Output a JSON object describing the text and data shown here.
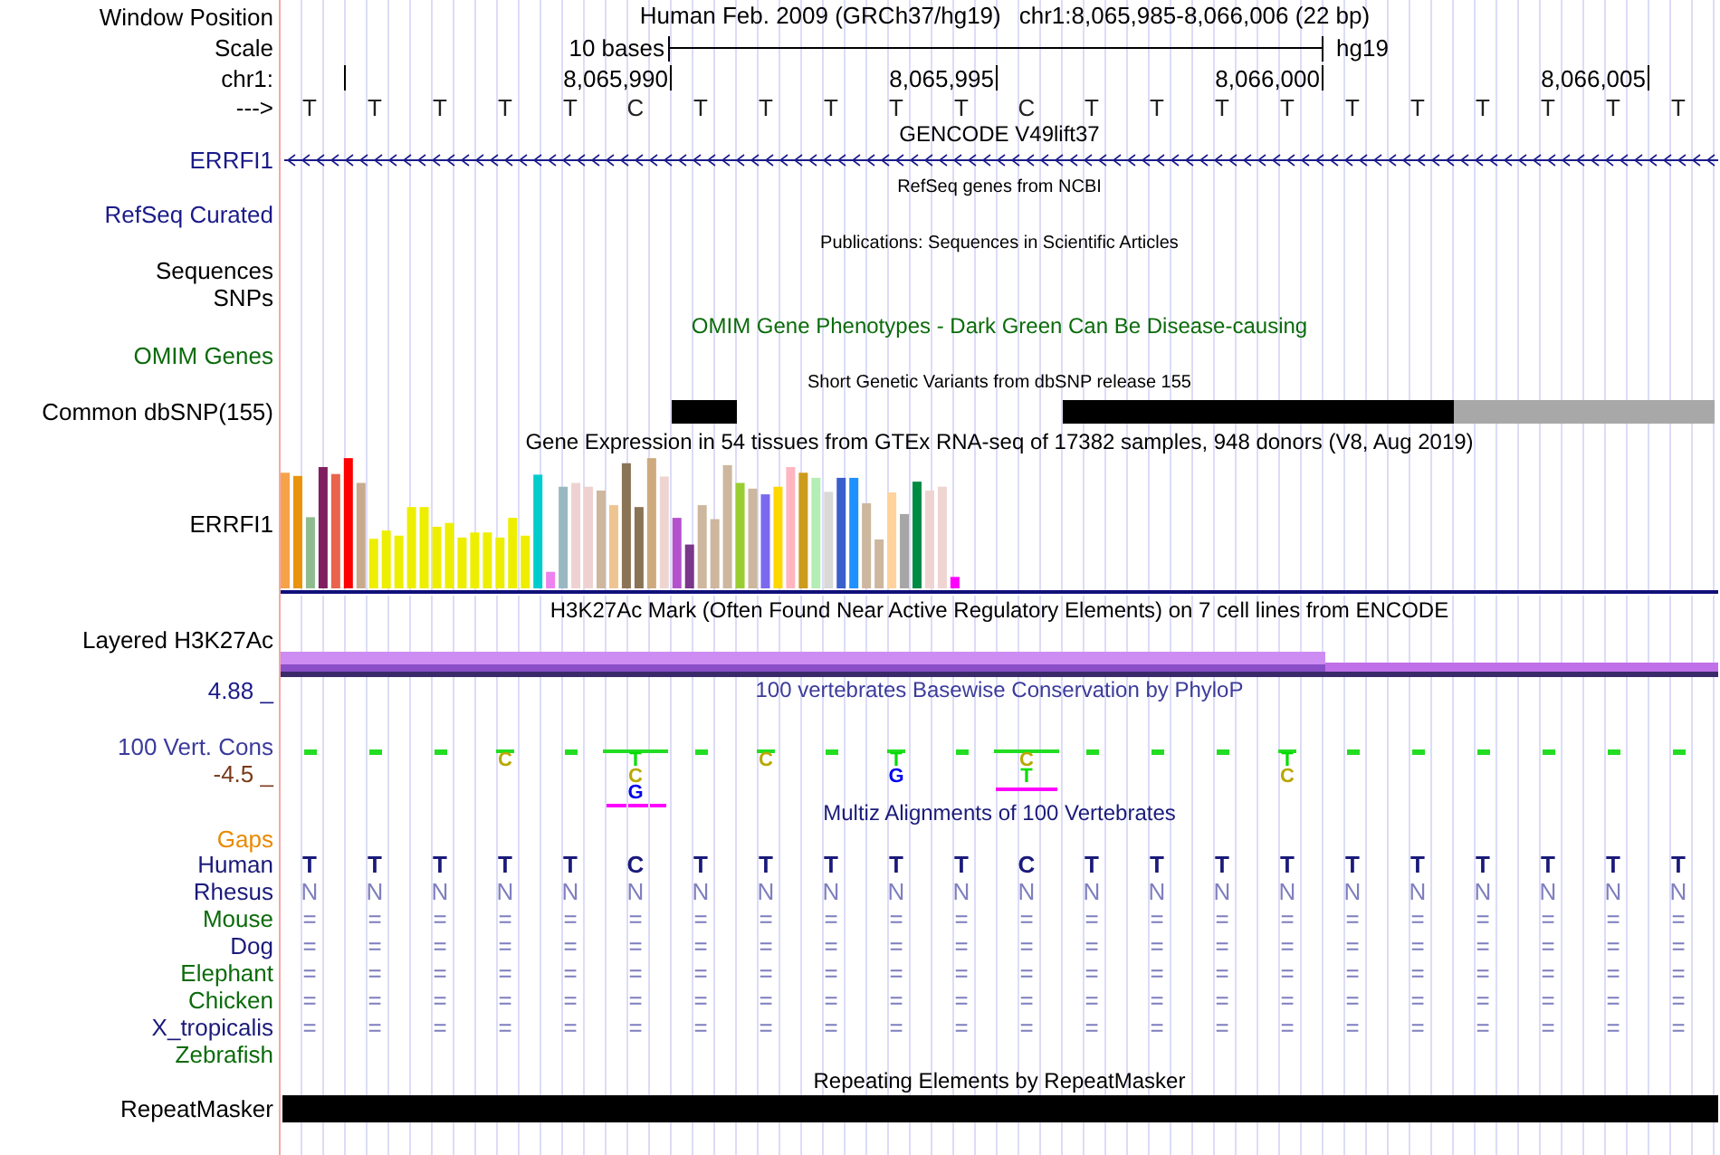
{
  "header": {
    "label": "Window Position",
    "assembly": "Human Feb. 2009 (GRCh37/hg19)",
    "position": "chr1:8,065,985-8,066,006 (22 bp)"
  },
  "scale": {
    "label": "Scale",
    "text": "10 bases",
    "assembly": "hg19"
  },
  "ruler": {
    "label": "chr1:",
    "ticks": [
      "8,065,990",
      "8,065,995",
      "8,066,000",
      "8,066,005"
    ]
  },
  "sequence": {
    "label": "--->",
    "bases": [
      "T",
      "T",
      "T",
      "T",
      "T",
      "C",
      "T",
      "T",
      "T",
      "T",
      "T",
      "C",
      "T",
      "T",
      "T",
      "T",
      "T",
      "T",
      "T",
      "T",
      "T",
      "T"
    ]
  },
  "gencode": {
    "title": "GENCODE V49lift37",
    "gene_label": "ERRFI1"
  },
  "refseq": {
    "title": "RefSeq genes from NCBI",
    "label": "RefSeq Curated"
  },
  "publications": {
    "title": "Publications: Sequences in Scientific Articles",
    "labels": [
      "Sequences",
      "SNPs"
    ]
  },
  "omim": {
    "title": "OMIM Gene Phenotypes - Dark Green Can Be Disease-causing",
    "label": "OMIM Genes"
  },
  "dbsnp": {
    "title": "Short Genetic Variants from dbSNP release 155",
    "label": "Common dbSNP(155)",
    "bases": [
      {
        "kind": "empty"
      },
      {
        "kind": "empty"
      },
      {
        "kind": "empty"
      },
      {
        "kind": "empty"
      },
      {
        "kind": "empty"
      },
      {
        "kind": "empty"
      },
      {
        "kind": "common"
      },
      {
        "kind": "empty"
      },
      {
        "kind": "empty"
      },
      {
        "kind": "empty"
      },
      {
        "kind": "empty"
      },
      {
        "kind": "empty"
      },
      {
        "kind": "common"
      },
      {
        "kind": "common"
      },
      {
        "kind": "common"
      },
      {
        "kind": "common"
      },
      {
        "kind": "common"
      },
      {
        "kind": "common"
      },
      {
        "kind": "filtered"
      },
      {
        "kind": "filtered"
      },
      {
        "kind": "filtered"
      },
      {
        "kind": "filtered"
      }
    ]
  },
  "gtex": {
    "title": "Gene Expression in 54 tissues from GTEx RNA-seq of 17382 samples, 948 donors (V8, Aug 2019)",
    "label": "ERRFI1"
  },
  "h3k27ac": {
    "title": "H3K27Ac Mark (Often Found Near Active Regulatory Elements) on 7 cell lines from ENCODE",
    "label": "Layered H3K27Ac"
  },
  "phylop": {
    "title": "100 vertebrates Basewise Conservation by PhyloP",
    "max": "4.88 _",
    "label": "100 Vert. Cons",
    "min": "-4.5 _",
    "columns": [
      {
        "kind": "tick"
      },
      {
        "kind": "tick"
      },
      {
        "kind": "tick"
      },
      {
        "kind": "logo",
        "underline": false,
        "letters": [
          {
            "letter": "C",
            "color": "#b8a800"
          }
        ]
      },
      {
        "kind": "tick"
      },
      {
        "kind": "logo",
        "underline": true,
        "letters": [
          {
            "letter": "T",
            "color": "#00dd00"
          },
          {
            "letter": "C",
            "color": "#b8a800"
          },
          {
            "letter": "G",
            "color": "#0000ee"
          }
        ]
      },
      {
        "kind": "tick"
      },
      {
        "kind": "logo",
        "underline": false,
        "letters": [
          {
            "letter": "C",
            "color": "#b8a800"
          }
        ]
      },
      {
        "kind": "tick"
      },
      {
        "kind": "logo",
        "underline": false,
        "letters": [
          {
            "letter": "T",
            "color": "#00dd00"
          },
          {
            "letter": "G",
            "color": "#0000ee"
          }
        ]
      },
      {
        "kind": "tick"
      },
      {
        "kind": "logo",
        "underline": true,
        "letters": [
          {
            "letter": "C",
            "color": "#b8a800"
          },
          {
            "letter": "T",
            "color": "#00dd00"
          }
        ]
      },
      {
        "kind": "tick"
      },
      {
        "kind": "tick"
      },
      {
        "kind": "tick"
      },
      {
        "kind": "logo",
        "underline": false,
        "letters": [
          {
            "letter": "T",
            "color": "#00dd00"
          },
          {
            "letter": "C",
            "color": "#b8a800"
          }
        ]
      },
      {
        "kind": "tick"
      },
      {
        "kind": "tick"
      },
      {
        "kind": "tick"
      },
      {
        "kind": "tick"
      },
      {
        "kind": "tick"
      },
      {
        "kind": "tick"
      }
    ]
  },
  "multiz": {
    "title": "Multiz Alignments of 100 Vertebrates",
    "gaps_label": "Gaps",
    "species": [
      {
        "name": "Human",
        "color": "#1a1a7a",
        "kind": "reference",
        "bases": [
          "T",
          "T",
          "T",
          "T",
          "T",
          "C",
          "T",
          "T",
          "T",
          "T",
          "T",
          "C",
          "T",
          "T",
          "T",
          "T",
          "T",
          "T",
          "T",
          "T",
          "T",
          "T"
        ]
      },
      {
        "name": "Rhesus",
        "color": "#1a1a7a",
        "kind": "aligned",
        "bases": [
          "N",
          "N",
          "N",
          "N",
          "N",
          "N",
          "N",
          "N",
          "N",
          "N",
          "N",
          "N",
          "N",
          "N",
          "N",
          "N",
          "N",
          "N",
          "N",
          "N",
          "N",
          "N"
        ]
      },
      {
        "name": "Mouse",
        "color": "#0b6b0b",
        "kind": "aligned",
        "bases": [
          "=",
          "=",
          "=",
          "=",
          "=",
          "=",
          "=",
          "=",
          "=",
          "=",
          "=",
          "=",
          "=",
          "=",
          "=",
          "=",
          "=",
          "=",
          "=",
          "=",
          "=",
          "="
        ]
      },
      {
        "name": "Dog",
        "color": "#1a1a7a",
        "kind": "aligned",
        "bases": [
          "=",
          "=",
          "=",
          "=",
          "=",
          "=",
          "=",
          "=",
          "=",
          "=",
          "=",
          "=",
          "=",
          "=",
          "=",
          "=",
          "=",
          "=",
          "=",
          "=",
          "=",
          "="
        ]
      },
      {
        "name": "Elephant",
        "color": "#0b6b0b",
        "kind": "aligned",
        "bases": [
          "=",
          "=",
          "=",
          "=",
          "=",
          "=",
          "=",
          "=",
          "=",
          "=",
          "=",
          "=",
          "=",
          "=",
          "=",
          "=",
          "=",
          "=",
          "=",
          "=",
          "=",
          "="
        ]
      },
      {
        "name": "Chicken",
        "color": "#0b6b0b",
        "kind": "aligned",
        "bases": [
          "=",
          "=",
          "=",
          "=",
          "=",
          "=",
          "=",
          "=",
          "=",
          "=",
          "=",
          "=",
          "=",
          "=",
          "=",
          "=",
          "=",
          "=",
          "=",
          "=",
          "=",
          "="
        ]
      },
      {
        "name": "X_tropicalis",
        "color": "#1a1a7a",
        "kind": "aligned",
        "bases": [
          "=",
          "=",
          "=",
          "=",
          "=",
          "=",
          "=",
          "=",
          "=",
          "=",
          "=",
          "=",
          "=",
          "=",
          "=",
          "=",
          "=",
          "=",
          "=",
          "=",
          "=",
          "="
        ]
      },
      {
        "name": "Zebrafish",
        "color": "#0b6b0b",
        "kind": "empty"
      }
    ]
  },
  "repeatmasker": {
    "title": "Repeating Elements by RepeatMasker",
    "label": "RepeatMasker"
  }
}
